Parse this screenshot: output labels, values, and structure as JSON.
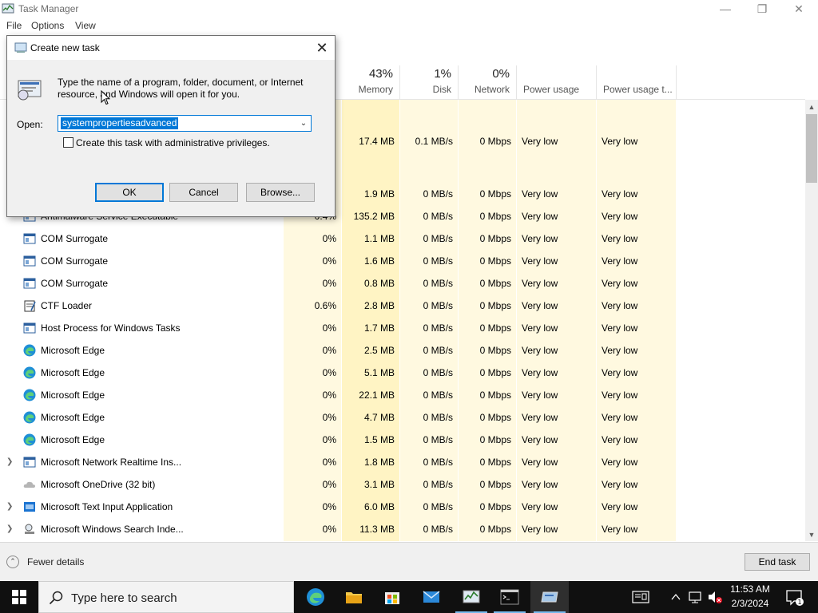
{
  "window": {
    "title": "Task Manager"
  },
  "menu": [
    "File",
    "Options",
    "View"
  ],
  "header": {
    "memory": {
      "pct": "43%",
      "label": "Memory"
    },
    "disk": {
      "pct": "1%",
      "label": "Disk"
    },
    "network": {
      "pct": "0%",
      "label": "Network"
    },
    "power": {
      "label": "Power usage"
    },
    "power_trend": {
      "label": "Power usage t..."
    }
  },
  "visible_partial": {
    "cpu_fragments": [
      "s",
      "5"
    ],
    "row_antimalware_cpu": "0.4%"
  },
  "rows": [
    {
      "name": "",
      "cpu": "",
      "mem": "17.4 MB",
      "disk": "0.1 MB/s",
      "net": "0 Mbps",
      "power": "Very low",
      "trend": "Very low",
      "y": 52,
      "icon": "none",
      "hidden": true
    },
    {
      "name": "",
      "cpu": "",
      "mem": "1.9 MB",
      "disk": "0 MB/s",
      "net": "0 Mbps",
      "power": "Very low",
      "trend": "Very low",
      "icon": "none",
      "hidden": true
    },
    {
      "name": "Antimalware Service Executable",
      "cpu": "0.4%",
      "mem": "135.2 MB",
      "disk": "0 MB/s",
      "net": "0 Mbps",
      "power": "Very low",
      "trend": "Very low",
      "icon": "window"
    },
    {
      "name": "COM Surrogate",
      "cpu": "0%",
      "mem": "1.1 MB",
      "disk": "0 MB/s",
      "net": "0 Mbps",
      "power": "Very low",
      "trend": "Very low",
      "icon": "window"
    },
    {
      "name": "COM Surrogate",
      "cpu": "0%",
      "mem": "1.6 MB",
      "disk": "0 MB/s",
      "net": "0 Mbps",
      "power": "Very low",
      "trend": "Very low",
      "icon": "window"
    },
    {
      "name": "COM Surrogate",
      "cpu": "0%",
      "mem": "0.8 MB",
      "disk": "0 MB/s",
      "net": "0 Mbps",
      "power": "Very low",
      "trend": "Very low",
      "icon": "window"
    },
    {
      "name": "CTF Loader",
      "cpu": "0.6%",
      "mem": "2.8 MB",
      "disk": "0 MB/s",
      "net": "0 Mbps",
      "power": "Very low",
      "trend": "Very low",
      "icon": "notepad"
    },
    {
      "name": "Host Process for Windows Tasks",
      "cpu": "0%",
      "mem": "1.7 MB",
      "disk": "0 MB/s",
      "net": "0 Mbps",
      "power": "Very low",
      "trend": "Very low",
      "icon": "window"
    },
    {
      "name": "Microsoft Edge",
      "cpu": "0%",
      "mem": "2.5 MB",
      "disk": "0 MB/s",
      "net": "0 Mbps",
      "power": "Very low",
      "trend": "Very low",
      "icon": "edge"
    },
    {
      "name": "Microsoft Edge",
      "cpu": "0%",
      "mem": "5.1 MB",
      "disk": "0 MB/s",
      "net": "0 Mbps",
      "power": "Very low",
      "trend": "Very low",
      "icon": "edge"
    },
    {
      "name": "Microsoft Edge",
      "cpu": "0%",
      "mem": "22.1 MB",
      "disk": "0 MB/s",
      "net": "0 Mbps",
      "power": "Very low",
      "trend": "Very low",
      "icon": "edge"
    },
    {
      "name": "Microsoft Edge",
      "cpu": "0%",
      "mem": "4.7 MB",
      "disk": "0 MB/s",
      "net": "0 Mbps",
      "power": "Very low",
      "trend": "Very low",
      "icon": "edge"
    },
    {
      "name": "Microsoft Edge",
      "cpu": "0%",
      "mem": "1.5 MB",
      "disk": "0 MB/s",
      "net": "0 Mbps",
      "power": "Very low",
      "trend": "Very low",
      "icon": "edge"
    },
    {
      "name": "Microsoft Network Realtime Ins...",
      "cpu": "0%",
      "mem": "1.8 MB",
      "disk": "0 MB/s",
      "net": "0 Mbps",
      "power": "Very low",
      "trend": "Very low",
      "icon": "window",
      "expand": true
    },
    {
      "name": "Microsoft OneDrive (32 bit)",
      "cpu": "0%",
      "mem": "3.1 MB",
      "disk": "0 MB/s",
      "net": "0 Mbps",
      "power": "Very low",
      "trend": "Very low",
      "icon": "cloud"
    },
    {
      "name": "Microsoft Text Input Application",
      "cpu": "0%",
      "mem": "6.0 MB",
      "disk": "0 MB/s",
      "net": "0 Mbps",
      "power": "Very low",
      "trend": "Very low",
      "icon": "blue",
      "expand": true
    },
    {
      "name": "Microsoft Windows Search Inde...",
      "cpu": "0%",
      "mem": "11.3 MB",
      "disk": "0 MB/s",
      "net": "0 Mbps",
      "power": "Very low",
      "trend": "Very low",
      "icon": "search",
      "expand": true
    }
  ],
  "footer": {
    "fewer_details": "Fewer details",
    "end_task": "End task"
  },
  "dialog": {
    "title": "Create new task",
    "description": "Type the name of a program, folder, document, or Internet resource, and Windows will open it for you.",
    "open_label": "Open:",
    "open_value": "systempropertiesadvanced",
    "admin_label": "Create this task with administrative privileges.",
    "ok": "OK",
    "cancel": "Cancel",
    "browse": "Browse..."
  },
  "taskbar": {
    "search_placeholder": "Type here to search",
    "time": "11:53 AM",
    "date": "2/3/2024"
  },
  "colors": {
    "accent": "#0078d7",
    "heat_light": "#fff9e0",
    "heat_mid": "#fff4c4",
    "taskbar": "#101010"
  }
}
